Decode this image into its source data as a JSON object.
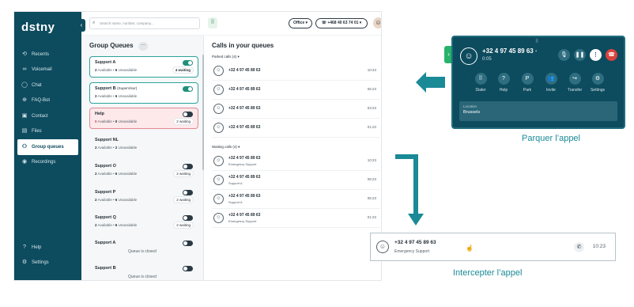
{
  "app": {
    "logo": "dstny",
    "search_placeholder": "Search name, number, company...",
    "office_label": "Office ▾",
    "number_label": "☏ +468 40 63 74 01 ▾",
    "nav": [
      {
        "label": "Recents",
        "icon": "recents-icon"
      },
      {
        "label": "Voicemail",
        "icon": "voicemail-icon"
      },
      {
        "label": "Chat",
        "icon": "chat-icon"
      },
      {
        "label": "FAQ-Bot",
        "icon": "globe-icon"
      },
      {
        "label": "Contact",
        "icon": "contact-icon"
      },
      {
        "label": "Files",
        "icon": "files-icon"
      },
      {
        "label": "Group queues",
        "icon": "group-queues-icon"
      },
      {
        "label": "Recordings",
        "icon": "recordings-icon"
      }
    ],
    "nav_bottom": [
      {
        "label": "Help",
        "icon": "help-icon"
      },
      {
        "label": "Settings",
        "icon": "settings-icon"
      }
    ]
  },
  "group_queues": {
    "title": "Group Queues",
    "more": "···",
    "items": [
      {
        "name": "Support A",
        "sub": "",
        "available": "2",
        "unavailable": "6",
        "waiting": "4 waiting",
        "toggle": "on"
      },
      {
        "name": "Support B",
        "sub": "(SuperVisor)",
        "available": "2",
        "unavailable": "6",
        "waiting": "",
        "toggle": "on"
      },
      {
        "name": "Help",
        "sub": "",
        "available": "0",
        "unavailable": "0",
        "waiting": "2 waiting",
        "toggle": "off"
      },
      {
        "name": "Support NL",
        "sub": "",
        "available": "2",
        "unavailable": "2",
        "waiting": "",
        "toggle": ""
      },
      {
        "name": "Support O",
        "sub": "",
        "available": "2",
        "unavailable": "6",
        "waiting": "2 waiting",
        "toggle": "off"
      },
      {
        "name": "Support P",
        "sub": "",
        "available": "2",
        "unavailable": "6",
        "waiting": "2 waiting",
        "toggle": "off"
      },
      {
        "name": "Support Q",
        "sub": "",
        "available": "2",
        "unavailable": "6",
        "waiting": "2 waiting",
        "toggle": "off"
      },
      {
        "name": "Support A",
        "sub": "",
        "closed": "Queue is closed",
        "toggle": "off"
      },
      {
        "name": "Support B",
        "sub": "",
        "closed": "Queue is closed",
        "toggle": "off"
      }
    ],
    "available_word": "Available",
    "unavailable_word": "Unavailable"
  },
  "calls": {
    "title": "Calls in your queues",
    "parked_label": "Parked calls (4) ▾",
    "waiting_label": "Waiting calls (4) ▾",
    "parked": [
      {
        "number": "+32 4 97 45 89 63",
        "time": "10:23"
      },
      {
        "number": "+32 4 97 45 89 63",
        "time": "05:23"
      },
      {
        "number": "+32 4 97 45 89 63",
        "time": "03:23"
      },
      {
        "number": "+32 4 97 45 89 63",
        "time": "01:23"
      }
    ],
    "waiting": [
      {
        "number": "+32 4 97 45 89 63",
        "queue": "Emergency Support",
        "time": "10:23"
      },
      {
        "number": "+32 4 97 45 89 63",
        "queue": "Support A",
        "time": "08:23"
      },
      {
        "number": "+32 4 97 45 89 63",
        "queue": "Support A",
        "time": "05:23"
      },
      {
        "number": "+32 4 97 45 89 63",
        "queue": "Emergency Support",
        "time": "01:23"
      }
    ]
  },
  "widget": {
    "number": "+32 4 97 45 89 63",
    "dot": "·",
    "duration": "0:05",
    "actions": [
      {
        "label": "Dialer",
        "icon": "dialer-icon",
        "glyph": "⠿"
      },
      {
        "label": "Help",
        "icon": "help-icon",
        "glyph": "?"
      },
      {
        "label": "Park",
        "icon": "park-icon",
        "glyph": "P"
      },
      {
        "label": "Invite",
        "icon": "invite-icon",
        "glyph": "👥"
      },
      {
        "label": "Transfer",
        "icon": "transfer-icon",
        "glyph": "↪"
      },
      {
        "label": "Settings",
        "icon": "settings-icon",
        "glyph": "⚙"
      }
    ],
    "location_key": "Location",
    "location_value": "Brussels"
  },
  "captions": {
    "park": "Parquer l’appel",
    "intercept": "Intercepter l’appel"
  },
  "intercept": {
    "number": "+32 4 97 45 89 63",
    "queue": "Emergency Support",
    "time": "10:23"
  },
  "colors": {
    "sidebar": "#0d4b5e",
    "accent": "#1a8a97",
    "toggle_on": "#1f8f7d",
    "alert": "#d93a4b",
    "hangup": "#d9433c",
    "widget_tab": "#27b36a"
  }
}
